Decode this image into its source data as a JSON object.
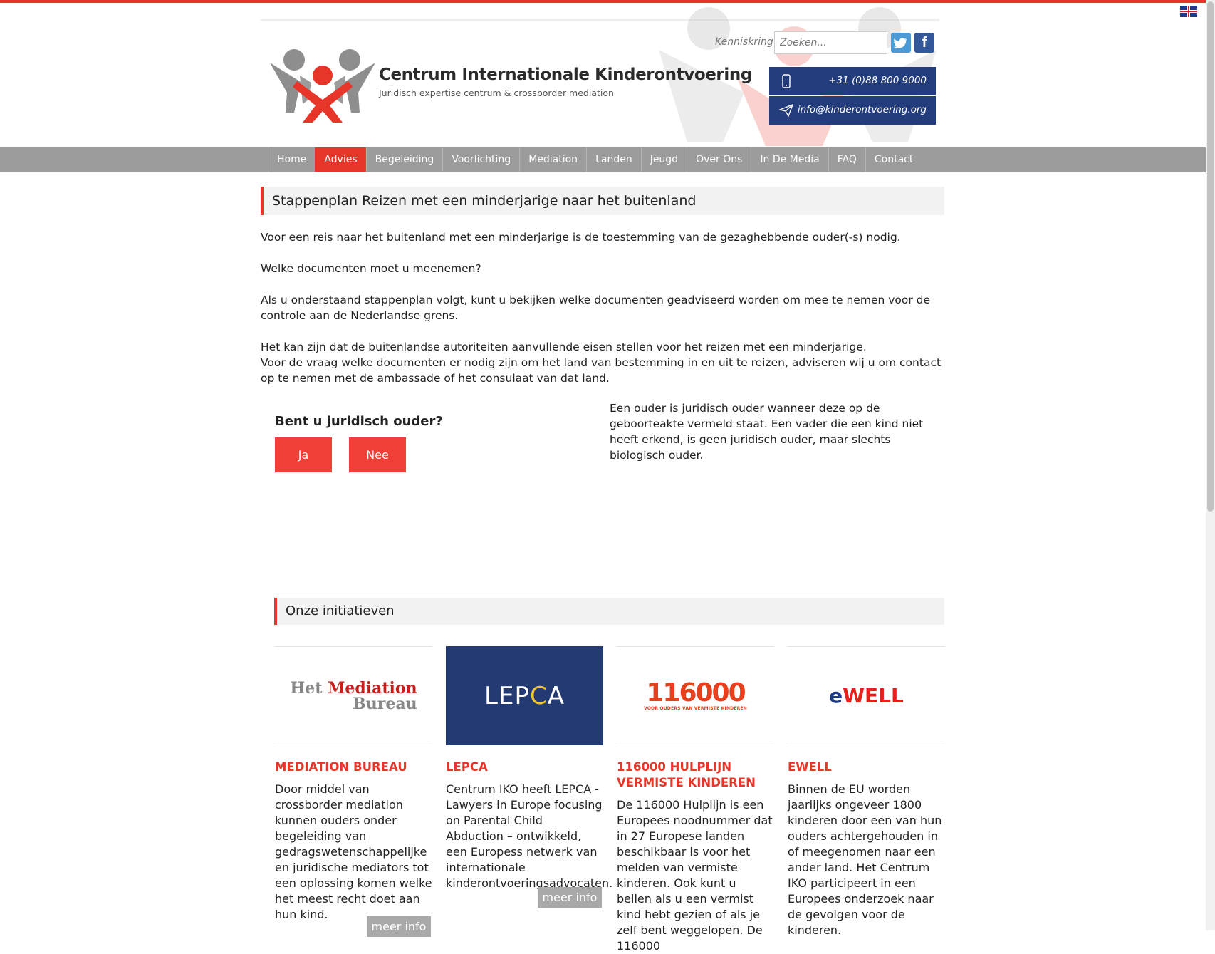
{
  "header": {
    "title": "Centrum Internationale Kinderontvoering",
    "subtitle": "Juridisch expertise centrum & crossborder mediation",
    "kenniskring": "Kenniskring",
    "search_placeholder": "Zoeken...",
    "phone": "+31 (0)88 800 9000",
    "email": "info@kinderontvoering.org",
    "twitter_glyph": "t",
    "facebook_glyph": "f"
  },
  "nav": {
    "items": [
      "Home",
      "Advies",
      "Begeleiding",
      "Voorlichting",
      "Mediation",
      "Landen",
      "Jeugd",
      "Over Ons",
      "In De Media",
      "FAQ",
      "Contact"
    ],
    "active": "Advies"
  },
  "main": {
    "page_title": "Stappenplan Reizen met een minderjarige naar het buitenland",
    "paragraphs": [
      "Voor een reis naar het buitenland met een minderjarige is de toestemming van de gezaghebbende ouder(-s) nodig.",
      "Welke documenten moet u meenemen?",
      "Als u onderstaand stappenplan volgt, kunt u bekijken welke documenten geadviseerd worden om mee te nemen voor de controle aan de Nederlandse grens.",
      "Het kan zijn dat de buitenlandse autoriteiten aanvullende eisen stellen voor het reizen met een minderjarige.",
      "Voor de vraag welke documenten er nodig zijn om het land van bestemming in en uit te reizen, adviseren wij u om contact op te nemen met de ambassade of het consulaat van dat land."
    ],
    "question": "Bent u juridisch ouder?",
    "yes_label": "Ja",
    "no_label": "Nee",
    "explanation": "Een ouder is juridisch ouder wanneer deze op de geboorteakte vermeld staat. Een vader die een kind niet heeft erkend, is geen juridisch ouder, maar slechts biologisch ouder."
  },
  "initiatives": {
    "heading": "Onze initiatieven",
    "more_label": "meer info",
    "cards": [
      {
        "logo_line1_a": "Het ",
        "logo_line1_b": "Mediation",
        "logo_line2": "Bureau",
        "title": "MEDIATION BUREAU",
        "text": "Door middel van crossborder mediation kunnen ouders onder begeleiding van gedragswetenschappelijke en juridische mediators tot een oplossing komen welke het meest recht doet aan hun kind."
      },
      {
        "logo_a": "LEP",
        "logo_b": "C",
        "logo_c": "A",
        "title": "LEPCA",
        "text": "Centrum IKO heeft LEPCA - Lawyers in Europe focusing on Parental Child Abduction – ontwikkeld, een Europess netwerk van internationale kinderontvoeringsadvocaten."
      },
      {
        "logo_number": "116000",
        "logo_tagline": "VOOR OUDERS VAN VERMISTE KINDEREN",
        "title": "116000 HULPLIJN VERMISTE KINDEREN",
        "text": "De 116000 Hulplijn is een Europees noodnummer dat in 27 Europese landen beschikbaar is voor het melden van vermiste kinderen. Ook kunt u bellen als u een vermist kind hebt gezien of als je zelf bent weggelopen. De 116000"
      },
      {
        "logo_a": "e",
        "logo_b": "WELL",
        "title": "EWELL",
        "text": "Binnen de EU worden jaarlijks ongeveer 1800 kinderen door een van hun ouders achtergehouden in of meegenomen naar een ander land. Het Centrum IKO participeert in een Europees onderzoek naar de gevolgen voor de kinderen."
      }
    ]
  },
  "colors": {
    "accent_red": "#e8352a",
    "navy": "#233c7c",
    "nav_gray": "#9c9c9c",
    "lepca_blue": "#233a73"
  },
  "icons": [
    "uk-flag-icon",
    "twitter-icon",
    "facebook-icon",
    "phone-icon",
    "paper-plane-icon"
  ]
}
